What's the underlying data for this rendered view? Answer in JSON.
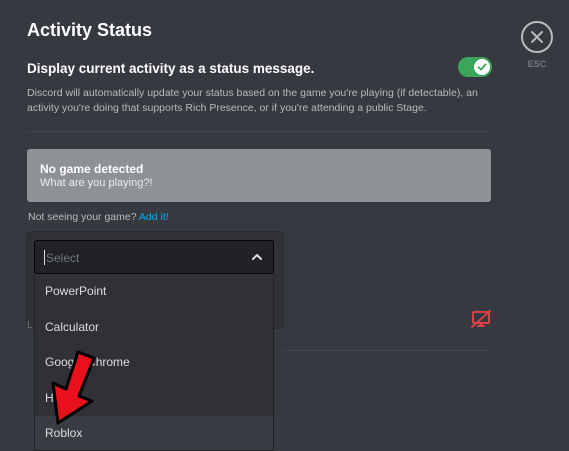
{
  "header": {
    "title": "Activity Status",
    "close_icon": "close-icon",
    "esc_label": "ESC"
  },
  "setting": {
    "label": "Display current activity as a status message.",
    "toggle_on": true,
    "description": "Discord will automatically update your status based on the game you're playing (if detectable), an activity you're doing that supports Rich Presence, or if you're attending a public Stage."
  },
  "no_game": {
    "title": "No game detected",
    "subtitle": "What are you playing?!"
  },
  "not_seeing": {
    "text": "Not seeing your game?",
    "link": "Add it!"
  },
  "select": {
    "placeholder": "Select",
    "options": [
      "PowerPoint",
      "Calculator",
      "Google Chrome",
      "Hulu",
      "Roblox"
    ],
    "highlighted": "Roblox"
  },
  "hidden_text": "L",
  "colors": {
    "accent_green": "#3ba55c",
    "link_blue": "#00aff4",
    "danger_red": "#ed4245",
    "arrow_red": "#e8101a"
  },
  "icons": {
    "screen_share_off": "screen-share-off-icon",
    "chevron": "chevron-up-icon",
    "arrow": "red-arrow-pointer"
  }
}
